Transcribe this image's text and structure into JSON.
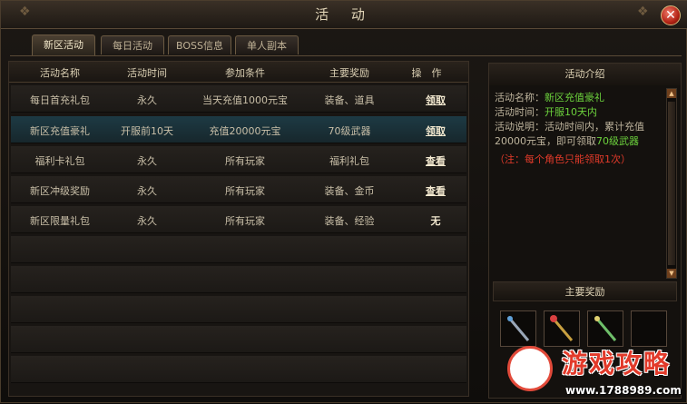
{
  "window": {
    "title": "活 动"
  },
  "tabs": [
    {
      "label": "新区活动",
      "active": true
    },
    {
      "label": "每日活动",
      "active": false
    },
    {
      "label": "BOSS信息",
      "active": false
    },
    {
      "label": "单人副本",
      "active": false
    }
  ],
  "table": {
    "headers": [
      "活动名称",
      "活动时间",
      "参加条件",
      "主要奖励",
      "操　作"
    ],
    "rows": [
      {
        "name": "每日首充礼包",
        "time": "永久",
        "condition": "当天充值1000元宝",
        "reward": "装备、道具",
        "action": "领取"
      },
      {
        "name": "新区充值豪礼",
        "time": "开服前10天",
        "condition": "充值20000元宝",
        "reward": "70级武器",
        "action": "领取"
      },
      {
        "name": "福利卡礼包",
        "time": "永久",
        "condition": "所有玩家",
        "reward": "福利礼包",
        "action": "查看"
      },
      {
        "name": "新区冲级奖励",
        "time": "永久",
        "condition": "所有玩家",
        "reward": "装备、金币",
        "action": "查看"
      },
      {
        "name": "新区限量礼包",
        "time": "永久",
        "condition": "所有玩家",
        "reward": "装备、经验",
        "action": "无"
      }
    ]
  },
  "intro": {
    "heading": "活动介绍",
    "name_label": "活动名称：",
    "name_value": "新区充值豪礼",
    "time_label": "活动时间：",
    "time_value": "开服10天内",
    "desc_line1": "活动说明：活动时间内，累计充值",
    "desc_line2_prefix": "20000元宝，即可领取",
    "desc_line2_value": "70级武器",
    "note": "（注：每个角色只能领取1次）"
  },
  "rewards": {
    "heading": "主要奖励"
  },
  "watermark": {
    "text": "游戏攻略",
    "url": "www.1788989.com"
  },
  "colors": {
    "highlight": "#6cd23c",
    "note": "#e23a2a",
    "selected_row": "#1d3a44"
  }
}
